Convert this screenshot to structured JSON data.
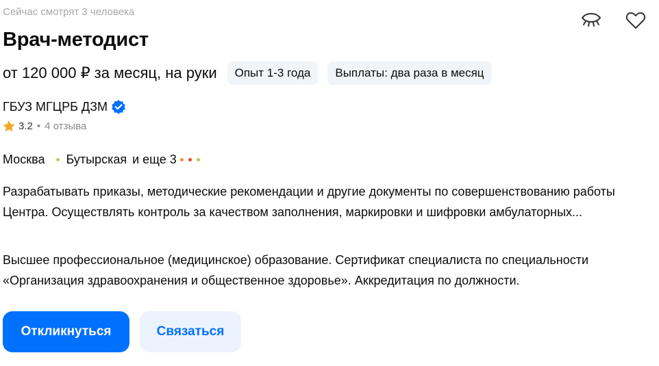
{
  "viewers": "Сейчас смотрят 3 человека",
  "title": "Врач-методист",
  "salary": "от 120 000 ₽ за месяц, на руки",
  "chips": {
    "experience": "Опыт 1-3 года",
    "payouts": "Выплаты: два раза в месяц"
  },
  "employer": {
    "name": "ГБУЗ МГЦРБ ДЗМ",
    "rating": "3.2",
    "separator": "•",
    "reviews": "4 отзыва"
  },
  "location": {
    "city": "Москва",
    "metro": "Бутырская",
    "more": "и еще 3",
    "metro_colors": [
      "#a8d64a",
      "#f08c3a",
      "#e8472b",
      "#a8d64a"
    ]
  },
  "description": {
    "responsibilities": "Разрабатывать приказы, методические рекомендации и другие документы по совершенствованию работы Центра. Осуществлять контроль за качеством заполнения, маркировки и шифровки амбулаторных...",
    "requirements": "Высшее профессиональное (медицинское) образование. Сертификат специалиста по специальности «Организация здравоохранения и общественное здоровье». Аккредитация по должности."
  },
  "actions": {
    "respond": "Откликнуться",
    "contact": "Связаться"
  },
  "icons": {
    "hide": "eye-closed-icon",
    "favorite": "heart-icon",
    "verified": "verified-badge-icon",
    "rating": "star-icon"
  },
  "colors": {
    "accent": "#0070ff",
    "accent_light": "#ebf3ff",
    "chip_bg": "#f1f4f9",
    "muted": "#a8a8a8",
    "star": "#f5a623"
  }
}
